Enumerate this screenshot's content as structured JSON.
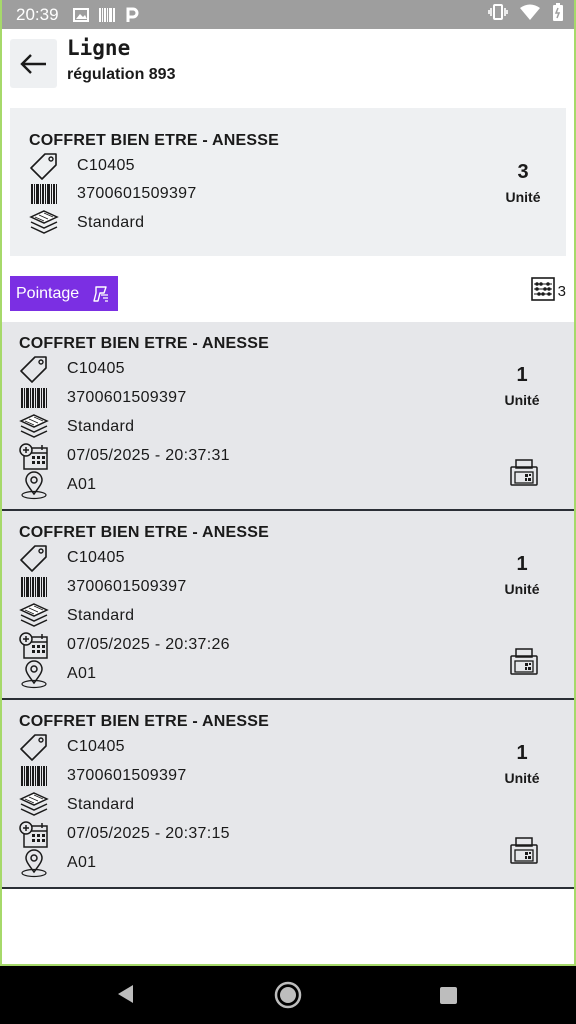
{
  "status_bar": {
    "time": "20:39"
  },
  "header": {
    "title": "Ligne",
    "subtitle": "régulation 893"
  },
  "summary": {
    "product_name": "COFFRET BIEN ETRE - ANESSE",
    "reference": "C10405",
    "barcode": "3700601509397",
    "variant": "Standard",
    "quantity": "3",
    "unit": "Unité"
  },
  "actions": {
    "pointage_label": "Pointage",
    "count": "3"
  },
  "items": [
    {
      "product_name": "COFFRET BIEN ETRE - ANESSE",
      "reference": "C10405",
      "barcode": "3700601509397",
      "variant": "Standard",
      "datetime": "07/05/2025 - 20:37:31",
      "location": "A01",
      "quantity": "1",
      "unit": "Unité"
    },
    {
      "product_name": "COFFRET BIEN ETRE - ANESSE",
      "reference": "C10405",
      "barcode": "3700601509397",
      "variant": "Standard",
      "datetime": "07/05/2025 - 20:37:26",
      "location": "A01",
      "quantity": "1",
      "unit": "Unité"
    },
    {
      "product_name": "COFFRET BIEN ETRE - ANESSE",
      "reference": "C10405",
      "barcode": "3700601509397",
      "variant": "Standard",
      "datetime": "07/05/2025 - 20:37:15",
      "location": "A01",
      "quantity": "1",
      "unit": "Unité"
    }
  ],
  "colors": {
    "accent": "#7b2fe3",
    "card_bg": "#e6e7ea",
    "summary_bg": "#eef0f2"
  }
}
